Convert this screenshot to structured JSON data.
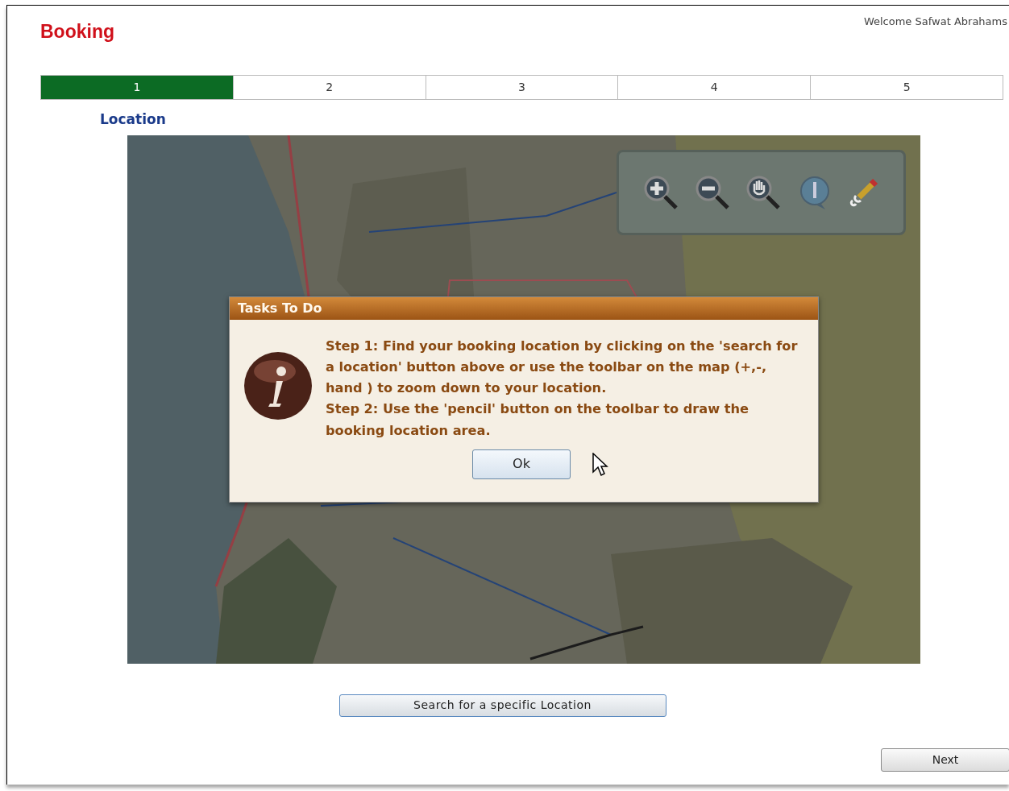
{
  "header": {
    "title": "Booking",
    "welcome": "Welcome Safwat Abrahams"
  },
  "steps": [
    {
      "label": "1",
      "selected": true
    },
    {
      "label": "2",
      "selected": false
    },
    {
      "label": "3",
      "selected": false
    },
    {
      "label": "4",
      "selected": false
    },
    {
      "label": "5",
      "selected": false
    }
  ],
  "section_title": "Location",
  "dialog": {
    "title": "Tasks To Do",
    "message": "Step 1: Find your booking location by clicking on the 'search for a location' button above or use the toolbar on the map (+,-, hand ) to zoom down to your location.\nStep 2: Use the 'pencil' button on the toolbar to draw the booking location area.",
    "button": "Ok"
  },
  "search_button": "Search for a specific Location",
  "next_button": "Next"
}
